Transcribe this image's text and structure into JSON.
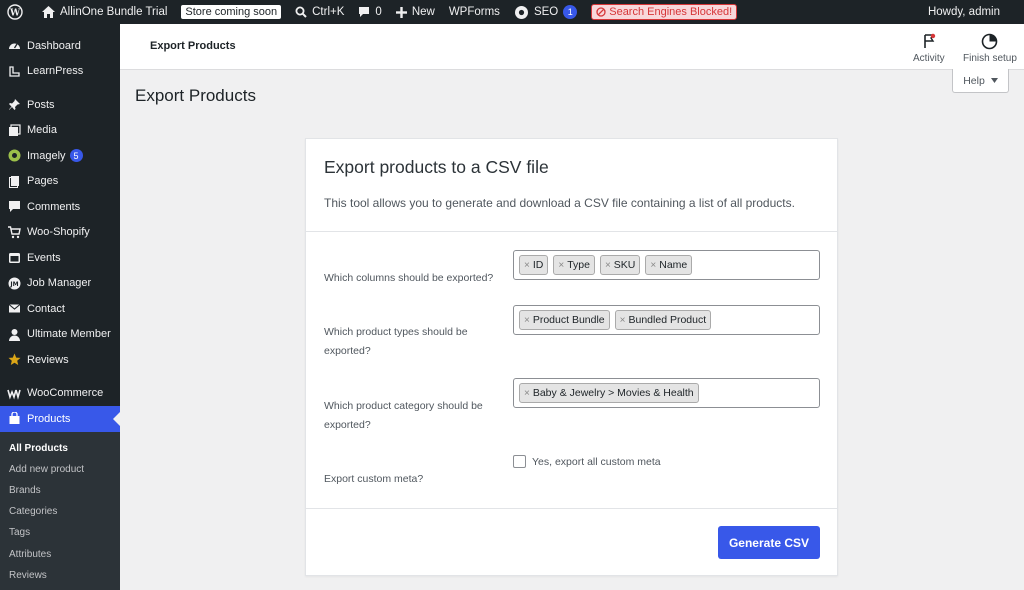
{
  "adminbar": {
    "site_name": "AllinOne Bundle Trial",
    "store_status": "Store coming soon",
    "search_shortcut": "Ctrl+K",
    "comments_count": "0",
    "new_label": "New",
    "wpforms_label": "WPForms",
    "seo_label": "SEO",
    "seo_badge": "1",
    "blocked_label": "Search Engines Blocked!",
    "howdy": "Howdy, admin"
  },
  "sidebar": {
    "items": [
      {
        "label": "Dashboard",
        "icon": "dashboard-icon"
      },
      {
        "label": "LearnPress",
        "icon": "learnpress-icon"
      },
      {
        "label": "Posts",
        "icon": "pin-icon"
      },
      {
        "label": "Media",
        "icon": "media-icon"
      },
      {
        "label": "Imagely",
        "icon": "imagely-icon",
        "count": "5"
      },
      {
        "label": "Pages",
        "icon": "pages-icon"
      },
      {
        "label": "Comments",
        "icon": "comment-icon"
      },
      {
        "label": "Woo-Shopify",
        "icon": "cart-icon"
      },
      {
        "label": "Events",
        "icon": "calendar-icon"
      },
      {
        "label": "Job Manager",
        "icon": "jobs-icon"
      },
      {
        "label": "Contact",
        "icon": "mail-icon"
      },
      {
        "label": "Ultimate Member",
        "icon": "user-icon"
      },
      {
        "label": "Reviews",
        "icon": "star-icon"
      },
      {
        "label": "WooCommerce",
        "icon": "woo-icon"
      },
      {
        "label": "Products",
        "icon": "products-icon"
      }
    ],
    "submenu": [
      "All Products",
      "Add new product",
      "Brands",
      "Categories",
      "Tags",
      "Attributes",
      "Reviews"
    ]
  },
  "header": {
    "title": "Export Products",
    "activity_label": "Activity",
    "finish_label": "Finish setup",
    "help_label": "Help"
  },
  "page": {
    "title": "Export Products"
  },
  "card": {
    "heading": "Export products to a CSV file",
    "description": "This tool allows you to generate and download a CSV file containing a list of all products.",
    "columns_label": "Which columns should be exported?",
    "columns_tags": [
      "ID",
      "Type",
      "SKU",
      "Name"
    ],
    "types_label": "Which product types should be exported?",
    "types_tags": [
      "Product Bundle",
      "Bundled Product"
    ],
    "category_label": "Which product category should be exported?",
    "category_tags": [
      "Baby & Jewelry > Movies & Health"
    ],
    "meta_label": "Export custom meta?",
    "meta_checkbox_label": "Yes, export all custom meta",
    "meta_checked": false,
    "generate_label": "Generate CSV"
  },
  "colors": {
    "accent": "#3858e9",
    "adminbar_bg": "#1d2327",
    "blocked": "#d63638"
  }
}
